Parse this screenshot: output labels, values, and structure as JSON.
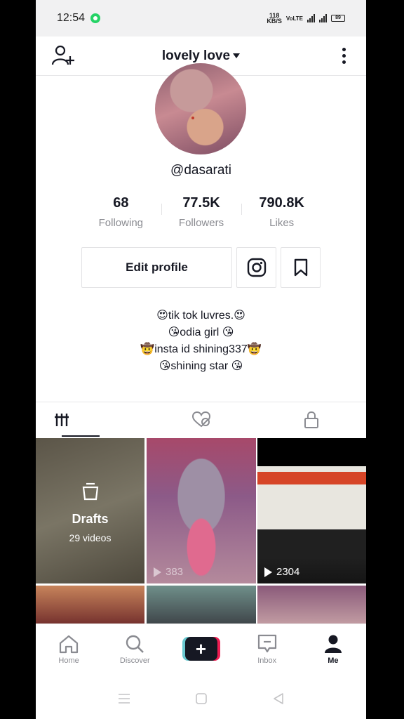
{
  "status_bar": {
    "time": "12:54",
    "net_speed": "118\nKB/S",
    "battery": "89"
  },
  "header": {
    "title": "lovely love"
  },
  "profile": {
    "username": "@dasarati",
    "stats": [
      {
        "value": "68",
        "label": "Following"
      },
      {
        "value": "77.5K",
        "label": "Followers"
      },
      {
        "value": "790.8K",
        "label": "Likes"
      }
    ],
    "edit_button": "Edit profile",
    "bio": [
      "😍tik tok luvres.😍",
      "😘odia girl 😘",
      "🤠insta id shining337🤠",
      "😘shining star 😘"
    ]
  },
  "grid": {
    "drafts_title": "Drafts",
    "drafts_count": "29 videos",
    "video1_views": "383",
    "video2_views": "2304"
  },
  "bottom_nav": {
    "home": "Home",
    "discover": "Discover",
    "create": "+",
    "inbox": "Inbox",
    "me": "Me"
  }
}
